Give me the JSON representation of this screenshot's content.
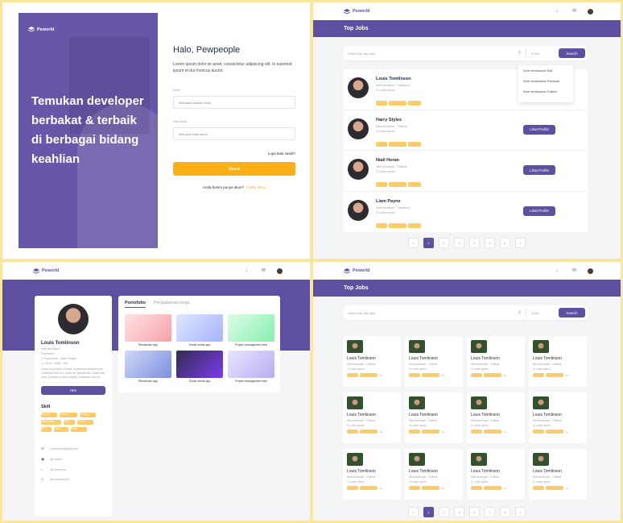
{
  "brand": "Peworld",
  "login": {
    "hero_line1": "Temukan developer",
    "hero_line2": "berbakat & terbaik",
    "hero_line3": "di berbagai bidang",
    "hero_line4": "keahlian",
    "greeting": "Halo, Pewpeople",
    "intro": "Lorem ipsum dolor sit amet, consectetur adipiscing elit. In euismod ipsum et dui rhoncus auctor.",
    "email_label": "Email",
    "email_placeholder": "Masukan alamat email",
    "password_label": "Kata Sandi",
    "password_placeholder": "Masukan kata sandi",
    "forgot": "Lupa kata sandi?",
    "submit": "Masuk",
    "register_prompt": "Anda belum punya akun?",
    "register_link": "Daftar disini"
  },
  "top_jobs": {
    "title": "Top Jobs",
    "search_placeholder": "Search for any skill",
    "sort_label": "Sort",
    "search_button": "Search",
    "sort_options": [
      "Sortir berdasarkan Skill",
      "Sortir berdasarkan Freelance",
      "Sortir berdasarkan Fulltime"
    ],
    "view_button": "Lihat Profile",
    "candidates": [
      {
        "name": "Louis Tomlinson",
        "role": "Web developer - Freelance",
        "location": "Lorem ipsum"
      },
      {
        "name": "Harry Styles",
        "role": "Web developer - Fulltime",
        "location": "Lorem ipsum"
      },
      {
        "name": "Niall Horan",
        "role": "Web developer - Fulltime",
        "location": "Lorem ipsum"
      },
      {
        "name": "Liam Payne",
        "role": "Web developer - Freelance",
        "location": "Lorem ipsum"
      }
    ],
    "pages": [
      "<",
      "1",
      "2",
      "3",
      "4",
      "5",
      "6",
      ">"
    ]
  },
  "profile": {
    "name": "Louis Tomlinson",
    "role": "Web developer",
    "type": "Freelancer",
    "location": "Purwokerto, Jawa Tengah",
    "phone": "0812 - 3456 - 789",
    "description": "Lorem ipsum dolor sit amet, consectetur adipiscing elit. Vestibulum erat orci, mollis nec gravida sed, ornare quis urna. Curabitur eu lacus fringilla, vestibulum risus at.",
    "hire_button": "Hire",
    "skill_title": "Skill",
    "skills": [
      "Phyton",
      "Laravel",
      "Golang",
      "JavaScript",
      "PHP",
      "HTML",
      "C++",
      "Kotlin",
      "Swift"
    ],
    "contacts": [
      "Louistommo@gmail.com",
      "@Louist91",
      "@Louistommo",
      "@Louistommo91"
    ],
    "tab_portfolio": "Portofolio",
    "tab_experience": "Pengalaman kerja",
    "portfolio": [
      "Remainder app",
      "Social media app",
      "Project management web",
      "Remainder app",
      "Social media app",
      "Project management web"
    ]
  },
  "grid_jobs": {
    "title": "Top Jobs",
    "search_placeholder": "Search for any skill",
    "sort_label": "Sortir",
    "search_button": "Search",
    "card_name": "Louis Tomlinson",
    "card_role": "Web developer - Fulltime",
    "card_location": "Lorem ipsum",
    "card_more": "6+",
    "pages": [
      "<",
      "1",
      "2",
      "3",
      "4",
      "5",
      "6",
      ">"
    ]
  },
  "colors": {
    "primary": "#5e50a1",
    "accent": "#fbb017",
    "bg": "#f4f5f7"
  }
}
